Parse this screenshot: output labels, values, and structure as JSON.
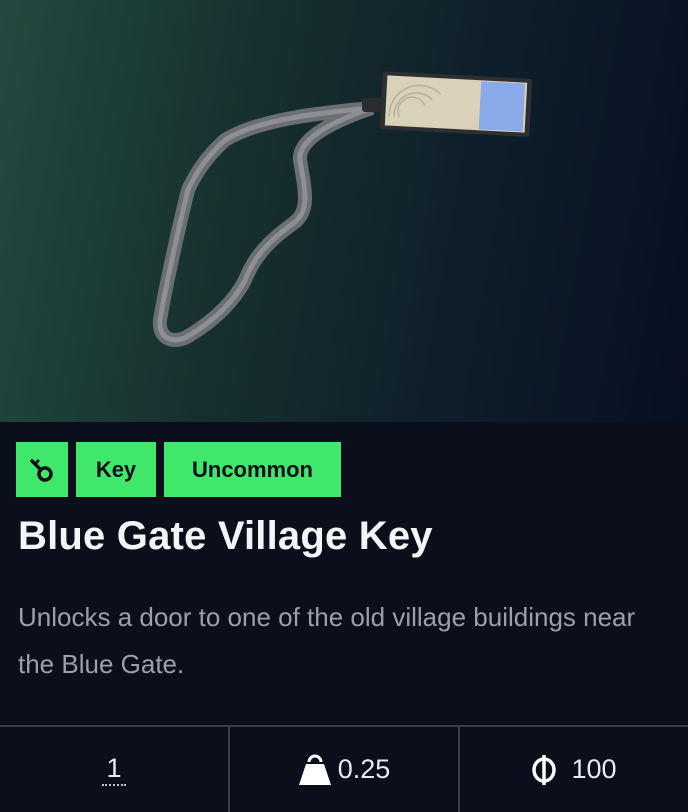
{
  "item": {
    "tags": [
      {
        "kind": "icon",
        "icon": "key-icon"
      },
      {
        "kind": "text",
        "label": "Key"
      },
      {
        "kind": "text",
        "label": "Uncommon"
      }
    ],
    "name": "Blue Gate Village Key",
    "description": "Unlocks a door to one of the old village buildings near the Blue Gate."
  },
  "stats": {
    "quantity": "1",
    "weight": "0.25",
    "weight_icon": "weight-icon",
    "value": "100",
    "value_icon": "coin-icon"
  },
  "colors": {
    "tag_bg": "#3fe86b",
    "card_bg": "#0b0f1c"
  }
}
